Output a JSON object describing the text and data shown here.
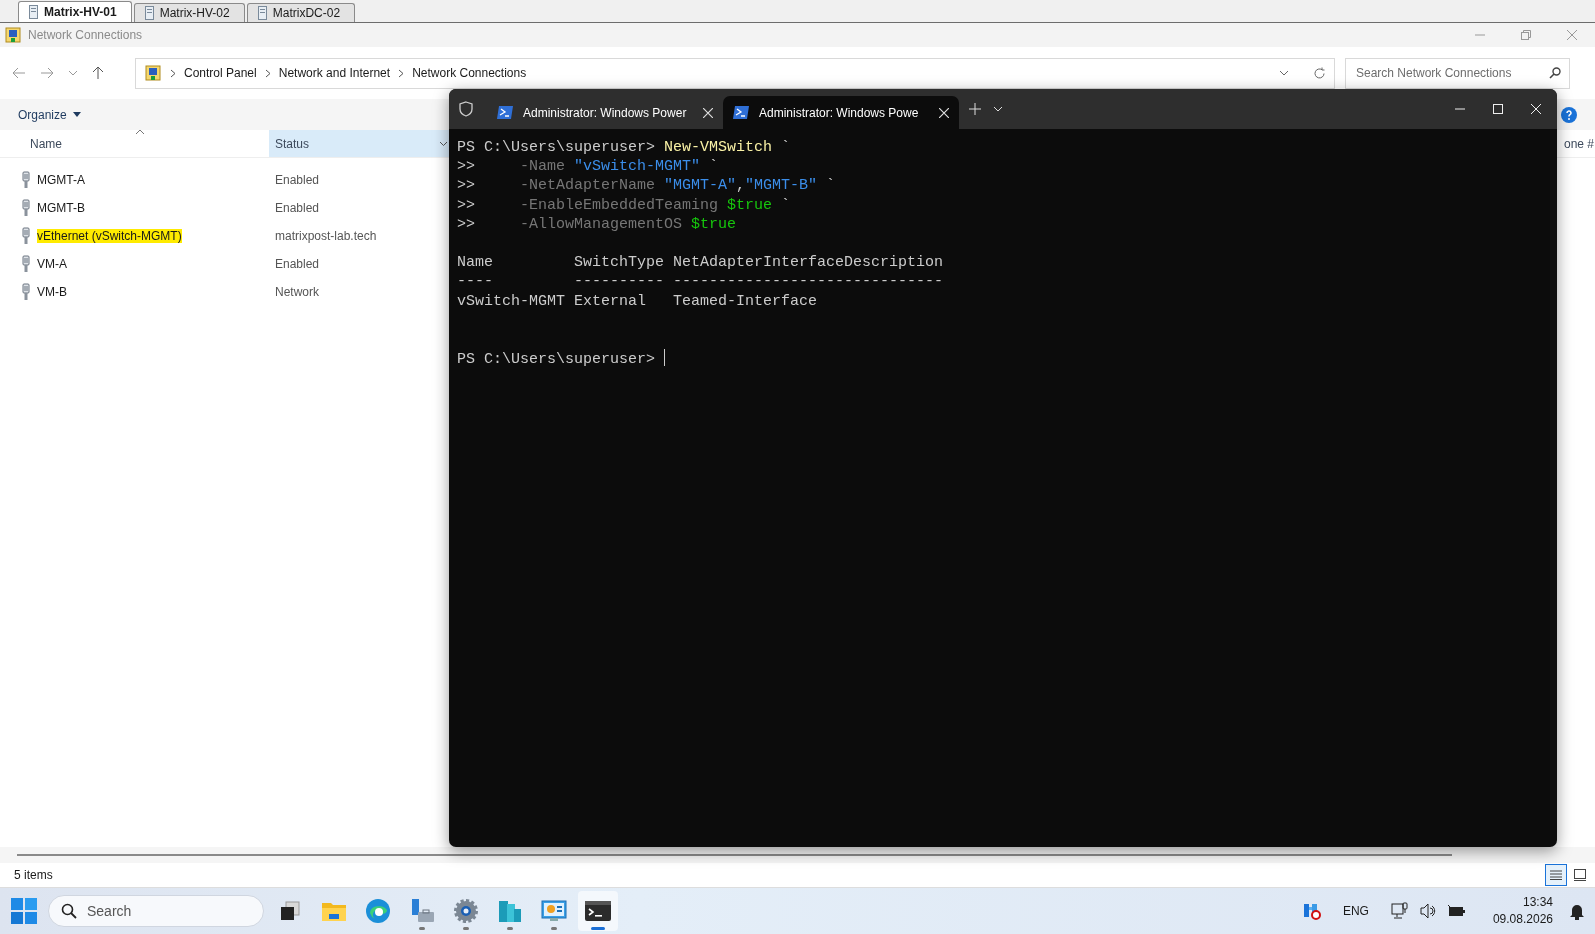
{
  "remote_tabs": [
    {
      "label": "Matrix-HV-01",
      "selected": true
    },
    {
      "label": "Matrix-HV-02",
      "selected": false
    },
    {
      "label": "MatrixDC-02",
      "selected": false
    }
  ],
  "window": {
    "title": "Network Connections",
    "active": false
  },
  "breadcrumb": [
    "Control Panel",
    "Network and Internet",
    "Network Connections"
  ],
  "search": {
    "placeholder": "Search Network Connections"
  },
  "toolbar": {
    "organize": "Organize"
  },
  "columns": [
    {
      "label": "Name",
      "sorted": true,
      "highlighted": false
    },
    {
      "label": "Status",
      "sorted": false,
      "highlighted": true
    },
    {
      "label": "one #",
      "sorted": false,
      "highlighted": false
    }
  ],
  "rows": [
    {
      "name": "MGMT-A",
      "status": "Enabled",
      "highlighted": false
    },
    {
      "name": "MGMT-B",
      "status": "Enabled",
      "highlighted": false
    },
    {
      "name": "vEthernet (vSwitch-MGMT)",
      "status": "matrixpost-lab.tech",
      "highlighted": true
    },
    {
      "name": "VM-A",
      "status": "Enabled",
      "highlighted": false
    },
    {
      "name": "VM-B",
      "status": "Network",
      "highlighted": false
    }
  ],
  "terminal": {
    "tabs": [
      {
        "title": "Administrator: Windows Power",
        "selected": false
      },
      {
        "title": "Administrator: Windows Powe",
        "selected": true
      }
    ],
    "command_lines": [
      [
        {
          "kind": "prompt",
          "text": "PS C:\\Users\\superuser>"
        },
        {
          "kind": "command",
          "text": " New-VMSwitch"
        },
        {
          "kind": "plain",
          "text": " `"
        }
      ],
      [
        {
          "kind": "continuation",
          "text": ">>"
        },
        {
          "kind": "param",
          "text": "-Name"
        },
        {
          "kind": "string",
          "text": " \"vSwitch-MGMT\""
        },
        {
          "kind": "plain",
          "text": " `"
        }
      ],
      [
        {
          "kind": "continuation",
          "text": ">>"
        },
        {
          "kind": "param",
          "text": "-NetAdapterName"
        },
        {
          "kind": "string",
          "text": " \"MGMT-A\""
        },
        {
          "kind": "plain",
          "text": ","
        },
        {
          "kind": "string",
          "text": "\"MGMT-B\""
        },
        {
          "kind": "plain",
          "text": " `"
        }
      ],
      [
        {
          "kind": "continuation",
          "text": ">>"
        },
        {
          "kind": "param",
          "text": "-EnableEmbeddedTeaming"
        },
        {
          "kind": "variable",
          "text": " $true"
        },
        {
          "kind": "plain",
          "text": " `"
        }
      ],
      [
        {
          "kind": "continuation",
          "text": ">>"
        },
        {
          "kind": "param",
          "text": "-AllowManagementOS"
        },
        {
          "kind": "variable",
          "text": " $true"
        }
      ]
    ],
    "table": {
      "columns": [
        "Name",
        "SwitchType",
        "NetAdapterInterfaceDescription"
      ],
      "rules": [
        "----",
        "----------",
        "------------------------------"
      ],
      "rows": [
        [
          "vSwitch-MGMT",
          "External",
          "Teamed-Interface"
        ]
      ]
    },
    "prompt": "PS C:\\Users\\superuser>"
  },
  "status_bar": {
    "count": "5 items",
    "views": [
      {
        "kind": "details",
        "selected": true
      },
      {
        "kind": "tiles",
        "selected": false
      }
    ]
  },
  "taskbar": {
    "search": "Search",
    "apps": [
      {
        "kind": "task_view",
        "running": false,
        "selected": false
      },
      {
        "kind": "explorer",
        "running": false,
        "selected": false
      },
      {
        "kind": "edge",
        "running": false,
        "selected": false
      },
      {
        "kind": "server_manager",
        "running": true,
        "selected": false
      },
      {
        "kind": "settings",
        "running": true,
        "selected": false
      },
      {
        "kind": "hyperv",
        "running": true,
        "selected": false
      },
      {
        "kind": "control_panel",
        "running": true,
        "selected": false
      },
      {
        "kind": "terminal",
        "running": true,
        "selected": true
      }
    ],
    "language": "ENG",
    "time": "13:34",
    "date": "09.08.2026"
  }
}
